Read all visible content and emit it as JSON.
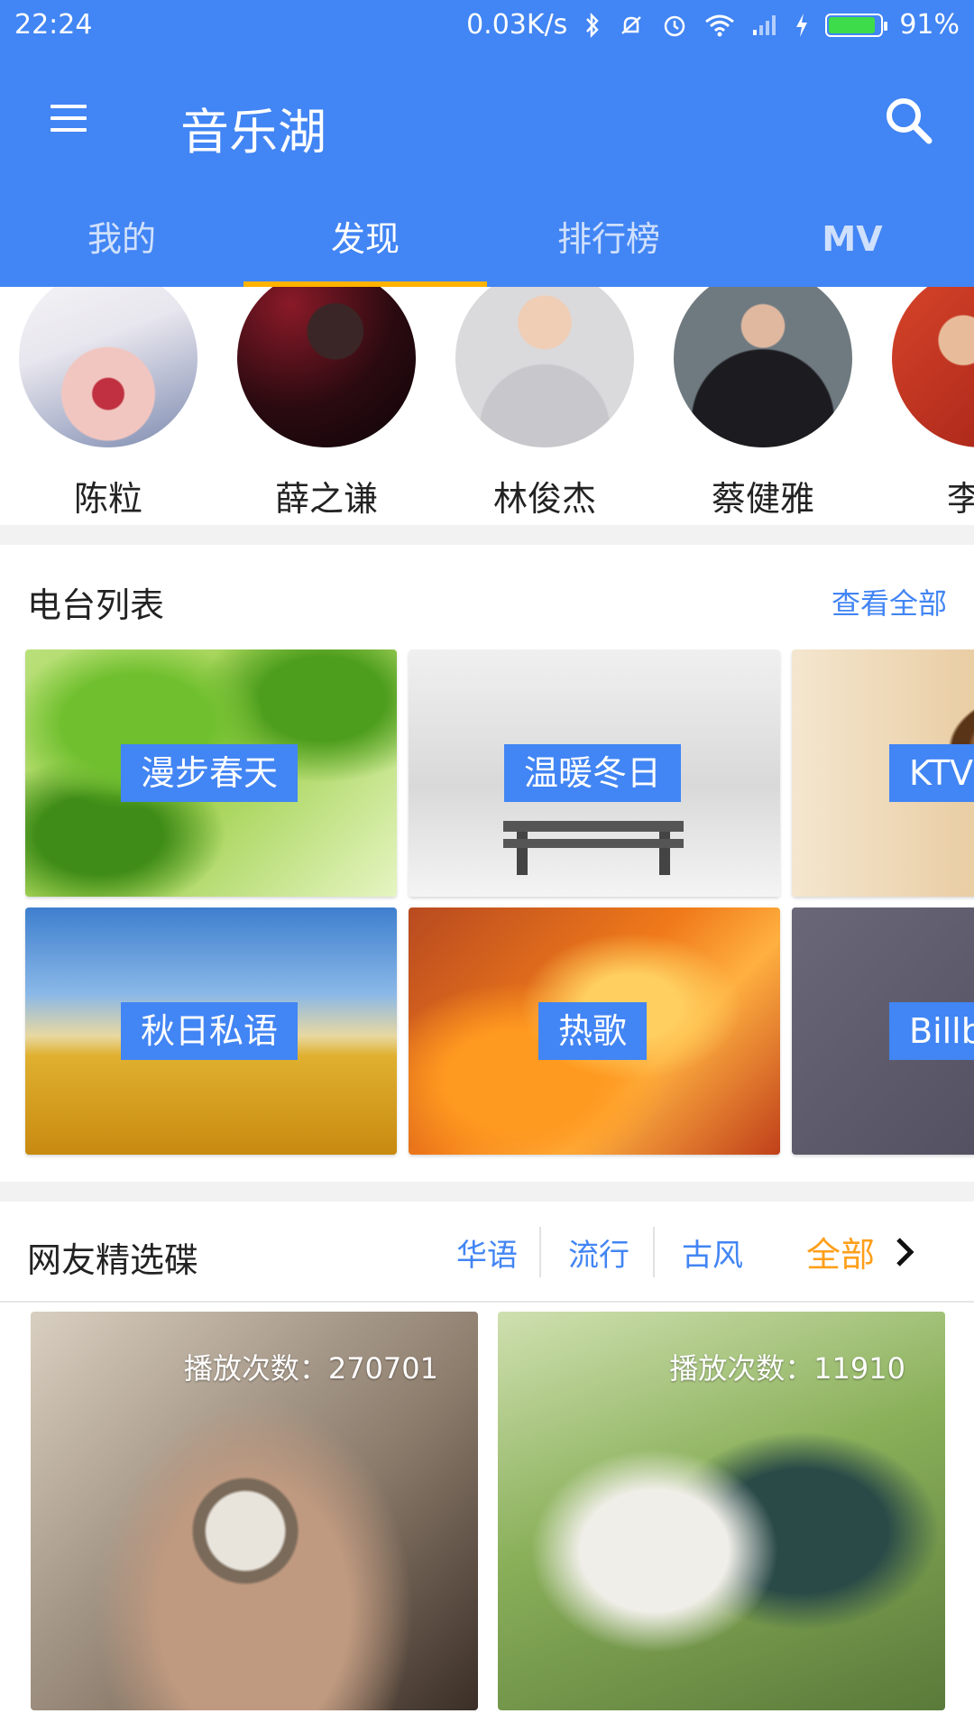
{
  "status_bar": {
    "time": "22:24",
    "speed": "0.03K/s",
    "battery_text": "91%",
    "battery_level": 0.91,
    "icons": [
      "bluetooth-icon",
      "mute-icon",
      "alarm-icon",
      "wifi-icon",
      "signal-icon",
      "charging-icon"
    ]
  },
  "toolbar": {
    "title": "音乐湖",
    "menu_icon": "menu-icon",
    "search_icon": "search-icon"
  },
  "tabs": [
    {
      "label": "我的",
      "active": false
    },
    {
      "label": "发现",
      "active": true
    },
    {
      "label": "排行榜",
      "active": false
    },
    {
      "label": "MV",
      "active": false
    }
  ],
  "artists": [
    {
      "name": "陈粒"
    },
    {
      "name": "薛之谦"
    },
    {
      "name": "林俊杰"
    },
    {
      "name": "蔡健雅"
    },
    {
      "name": "李荣"
    }
  ],
  "radio": {
    "title": "电台列表",
    "view_all": "查看全部",
    "stations": [
      {
        "label": "漫步春天"
      },
      {
        "label": "温暖冬日"
      },
      {
        "label": "KTV"
      },
      {
        "label": "秋日私语"
      },
      {
        "label": "热歌"
      },
      {
        "label": "Billb"
      }
    ]
  },
  "picks": {
    "title": "网友精选碟",
    "filters": [
      "华语",
      "流行",
      "古风",
      "全部"
    ],
    "active_filter": "全部",
    "playlists": [
      {
        "play_count": "播放次数：270701"
      },
      {
        "play_count": "播放次数：11910"
      }
    ]
  },
  "colors": {
    "primary": "#4285f4",
    "tab_indicator": "#ffb300",
    "active_filter": "#ff9f1a"
  }
}
